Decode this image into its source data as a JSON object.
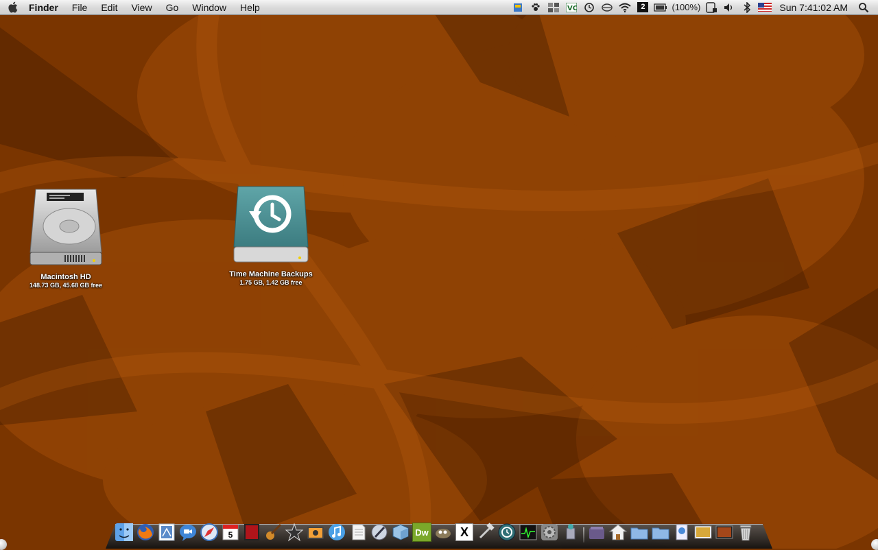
{
  "menubar": {
    "app_name": "Finder",
    "menus": [
      "File",
      "Edit",
      "View",
      "Go",
      "Window",
      "Help"
    ],
    "battery_text": "(100%)",
    "spaces_number": "2",
    "clock": "Sun 7:41:02 AM"
  },
  "desktop": {
    "icons": [
      {
        "name": "Macintosh HD",
        "info": "148.73 GB, 45.68 GB free"
      },
      {
        "name": "Time Machine Backups",
        "info": "1.75 GB, 1.42 GB free"
      }
    ]
  },
  "dock": {
    "calendar_day": "5",
    "dreamweaver_label": "Dw",
    "x11_label": "X"
  },
  "colors": {
    "wallpaper_base": "#7a3500",
    "time_machine_drive": "#4e8e92"
  }
}
